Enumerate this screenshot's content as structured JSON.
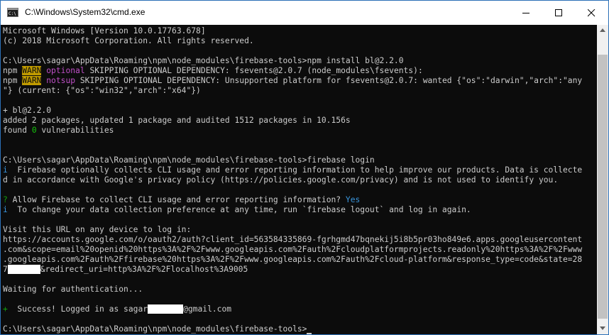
{
  "window": {
    "title": "C:\\Windows\\System32\\cmd.exe",
    "icon": "cmd-console-icon",
    "controls": [
      "minimize-icon",
      "maximize-icon",
      "close-icon"
    ]
  },
  "colors": {
    "background": "#0c0c0c",
    "text": "#cccccc",
    "warn_bg": "#c19c00",
    "magenta": "#c050c8",
    "cyan": "#3a96dd",
    "green": "#13a10e"
  },
  "console": {
    "l1": "Microsoft Windows [Version 10.0.17763.678]",
    "l2": "(c) 2018 Microsoft Corporation. All rights reserved.",
    "l3": "C:\\Users\\sagar\\AppData\\Roaming\\npm\\node_modules\\firebase-tools>npm install bl@2.2.0",
    "l4": {
      "npm": "npm ",
      "warn": "WARN",
      "sp": " ",
      "tag": "optional",
      "rest": " SKIPPING OPTIONAL DEPENDENCY: fsevents@2.0.7 (node_modules\\fsevents):"
    },
    "l5": {
      "npm": "npm ",
      "warn": "WARN",
      "sp": " ",
      "tag": "notsup",
      "rest": " SKIPPING OPTIONAL DEPENDENCY: Unsupported platform for fsevents@2.0.7: wanted {\"os\":\"darwin\",\"arch\":\"any"
    },
    "l6": "\"} (current: {\"os\":\"win32\",\"arch\":\"x64\"})",
    "l7": "+ bl@2.2.0",
    "l8": "added 2 packages, updated 1 package and audited 1512 packages in 10.156s",
    "l9": {
      "pre": "found ",
      "num": "0",
      "post": " vulnerabilities"
    },
    "l10": "C:\\Users\\sagar\\AppData\\Roaming\\npm\\node_modules\\firebase-tools>firebase login",
    "l11": {
      "mark": "i",
      "text": "  Firebase optionally collects CLI usage and error reporting information to help improve our products. Data is collecte"
    },
    "l12": "d in accordance with Google's privacy policy (https://policies.google.com/privacy) and is not used to identify you.",
    "l13": {
      "mark": "?",
      "text": " Allow Firebase to collect CLI usage and error reporting information? ",
      "answer": "Yes"
    },
    "l14": {
      "mark": "i",
      "text": "  To change your data collection preference at any time, run `firebase logout` and log in again."
    },
    "l15": "Visit this URL on any device to log in:",
    "l16": "https://accounts.google.com/o/oauth2/auth?client_id=563584335869-fgrhgmd47bqnekij5i8b5pr03ho849e6.apps.googleusercontent",
    "l17": ".com&scope=email%20openid%20https%3A%2F%2Fwww.googleapis.com%2Fauth%2Fcloudplatformprojects.readonly%20https%3A%2F%2Fwww",
    "l18": ".googleapis.com%2Fauth%2Ffirebase%20https%3A%2F%2Fwww.googleapis.com%2Fauth%2Fcloud-platform&response_type=code&state=28",
    "l19": {
      "pre": "7",
      "post": "&redirect_uri=http%3A%2F%2Flocalhost%3A9005"
    },
    "l20": "Waiting for authentication...",
    "l21": {
      "mark": "+",
      "text": "  Success! Logged in as sagar",
      "post": "@gmail.com"
    },
    "l22": "C:\\Users\\sagar\\AppData\\Roaming\\npm\\node_modules\\firebase-tools>"
  }
}
